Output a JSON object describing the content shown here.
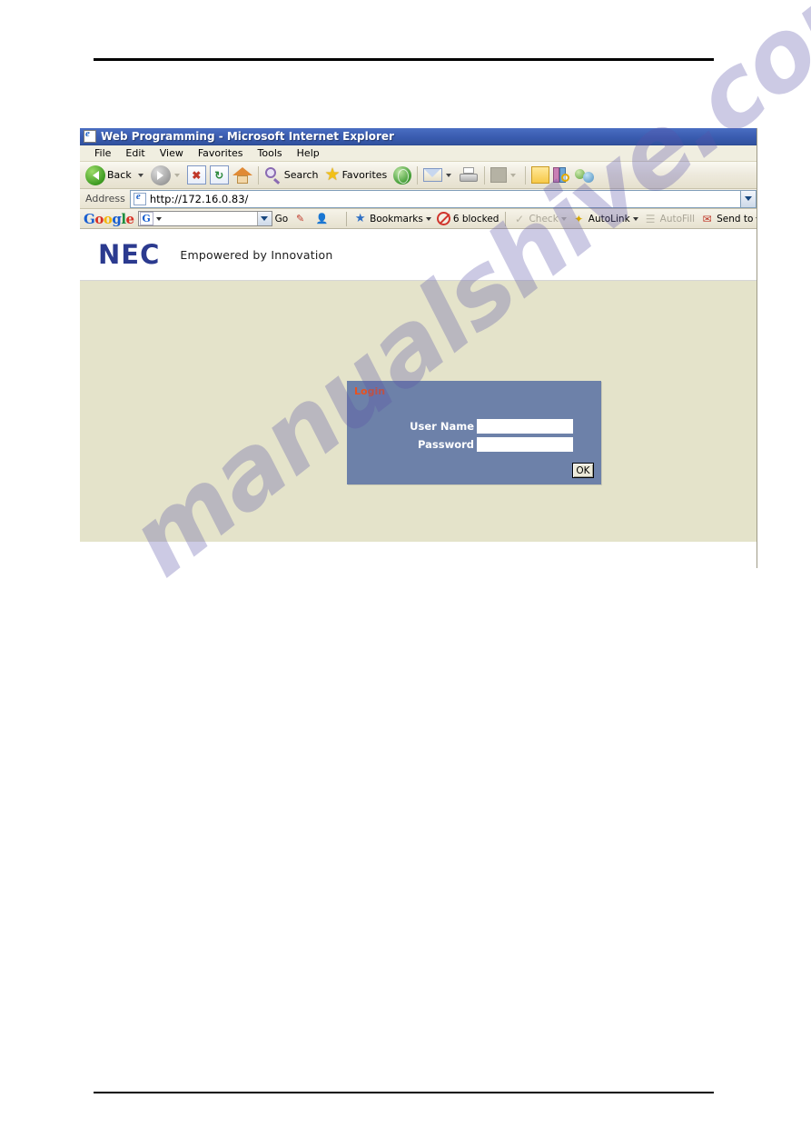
{
  "watermark": {
    "text": "manualshive.com"
  },
  "browser": {
    "titlebar": {
      "title": "Web Programming - Microsoft Internet Explorer",
      "icon": "ie-page-icon"
    },
    "menubar": {
      "items": [
        {
          "label": "File"
        },
        {
          "label": "Edit"
        },
        {
          "label": "View"
        },
        {
          "label": "Favorites"
        },
        {
          "label": "Tools"
        },
        {
          "label": "Help"
        }
      ]
    },
    "toolbar": {
      "back_label": "Back",
      "search_label": "Search",
      "favorites_label": "Favorites"
    },
    "addressbar": {
      "label": "Address",
      "url": "http://172.16.0.83/",
      "placeholder": "http://172.16.0.83/"
    },
    "google_toolbar": {
      "logo": {
        "g1": "G",
        "o1": "o",
        "o2": "o",
        "g2": "g",
        "l": "l",
        "e": "e"
      },
      "search_placeholder": "",
      "search_value": "",
      "go_label": "Go",
      "bookmarks_label": "Bookmarks",
      "blocked_label": "6 blocked",
      "check_label": "Check",
      "autolink_label": "AutoLink",
      "autofill_label": "AutoFill",
      "sendto_label": "Send to"
    }
  },
  "page": {
    "header": {
      "logo_text": "NEC",
      "tagline": "Empowered by Innovation"
    },
    "login": {
      "title": "Login",
      "username_label": "User Name",
      "username_value": "",
      "password_label": "Password",
      "password_value": "",
      "ok_label": "OK"
    },
    "colors": {
      "content_bg": "#e4e3ca",
      "login_bg": "#6d81a9",
      "login_title": "#e8521f",
      "nec_blue": "#2b3a8f"
    }
  }
}
